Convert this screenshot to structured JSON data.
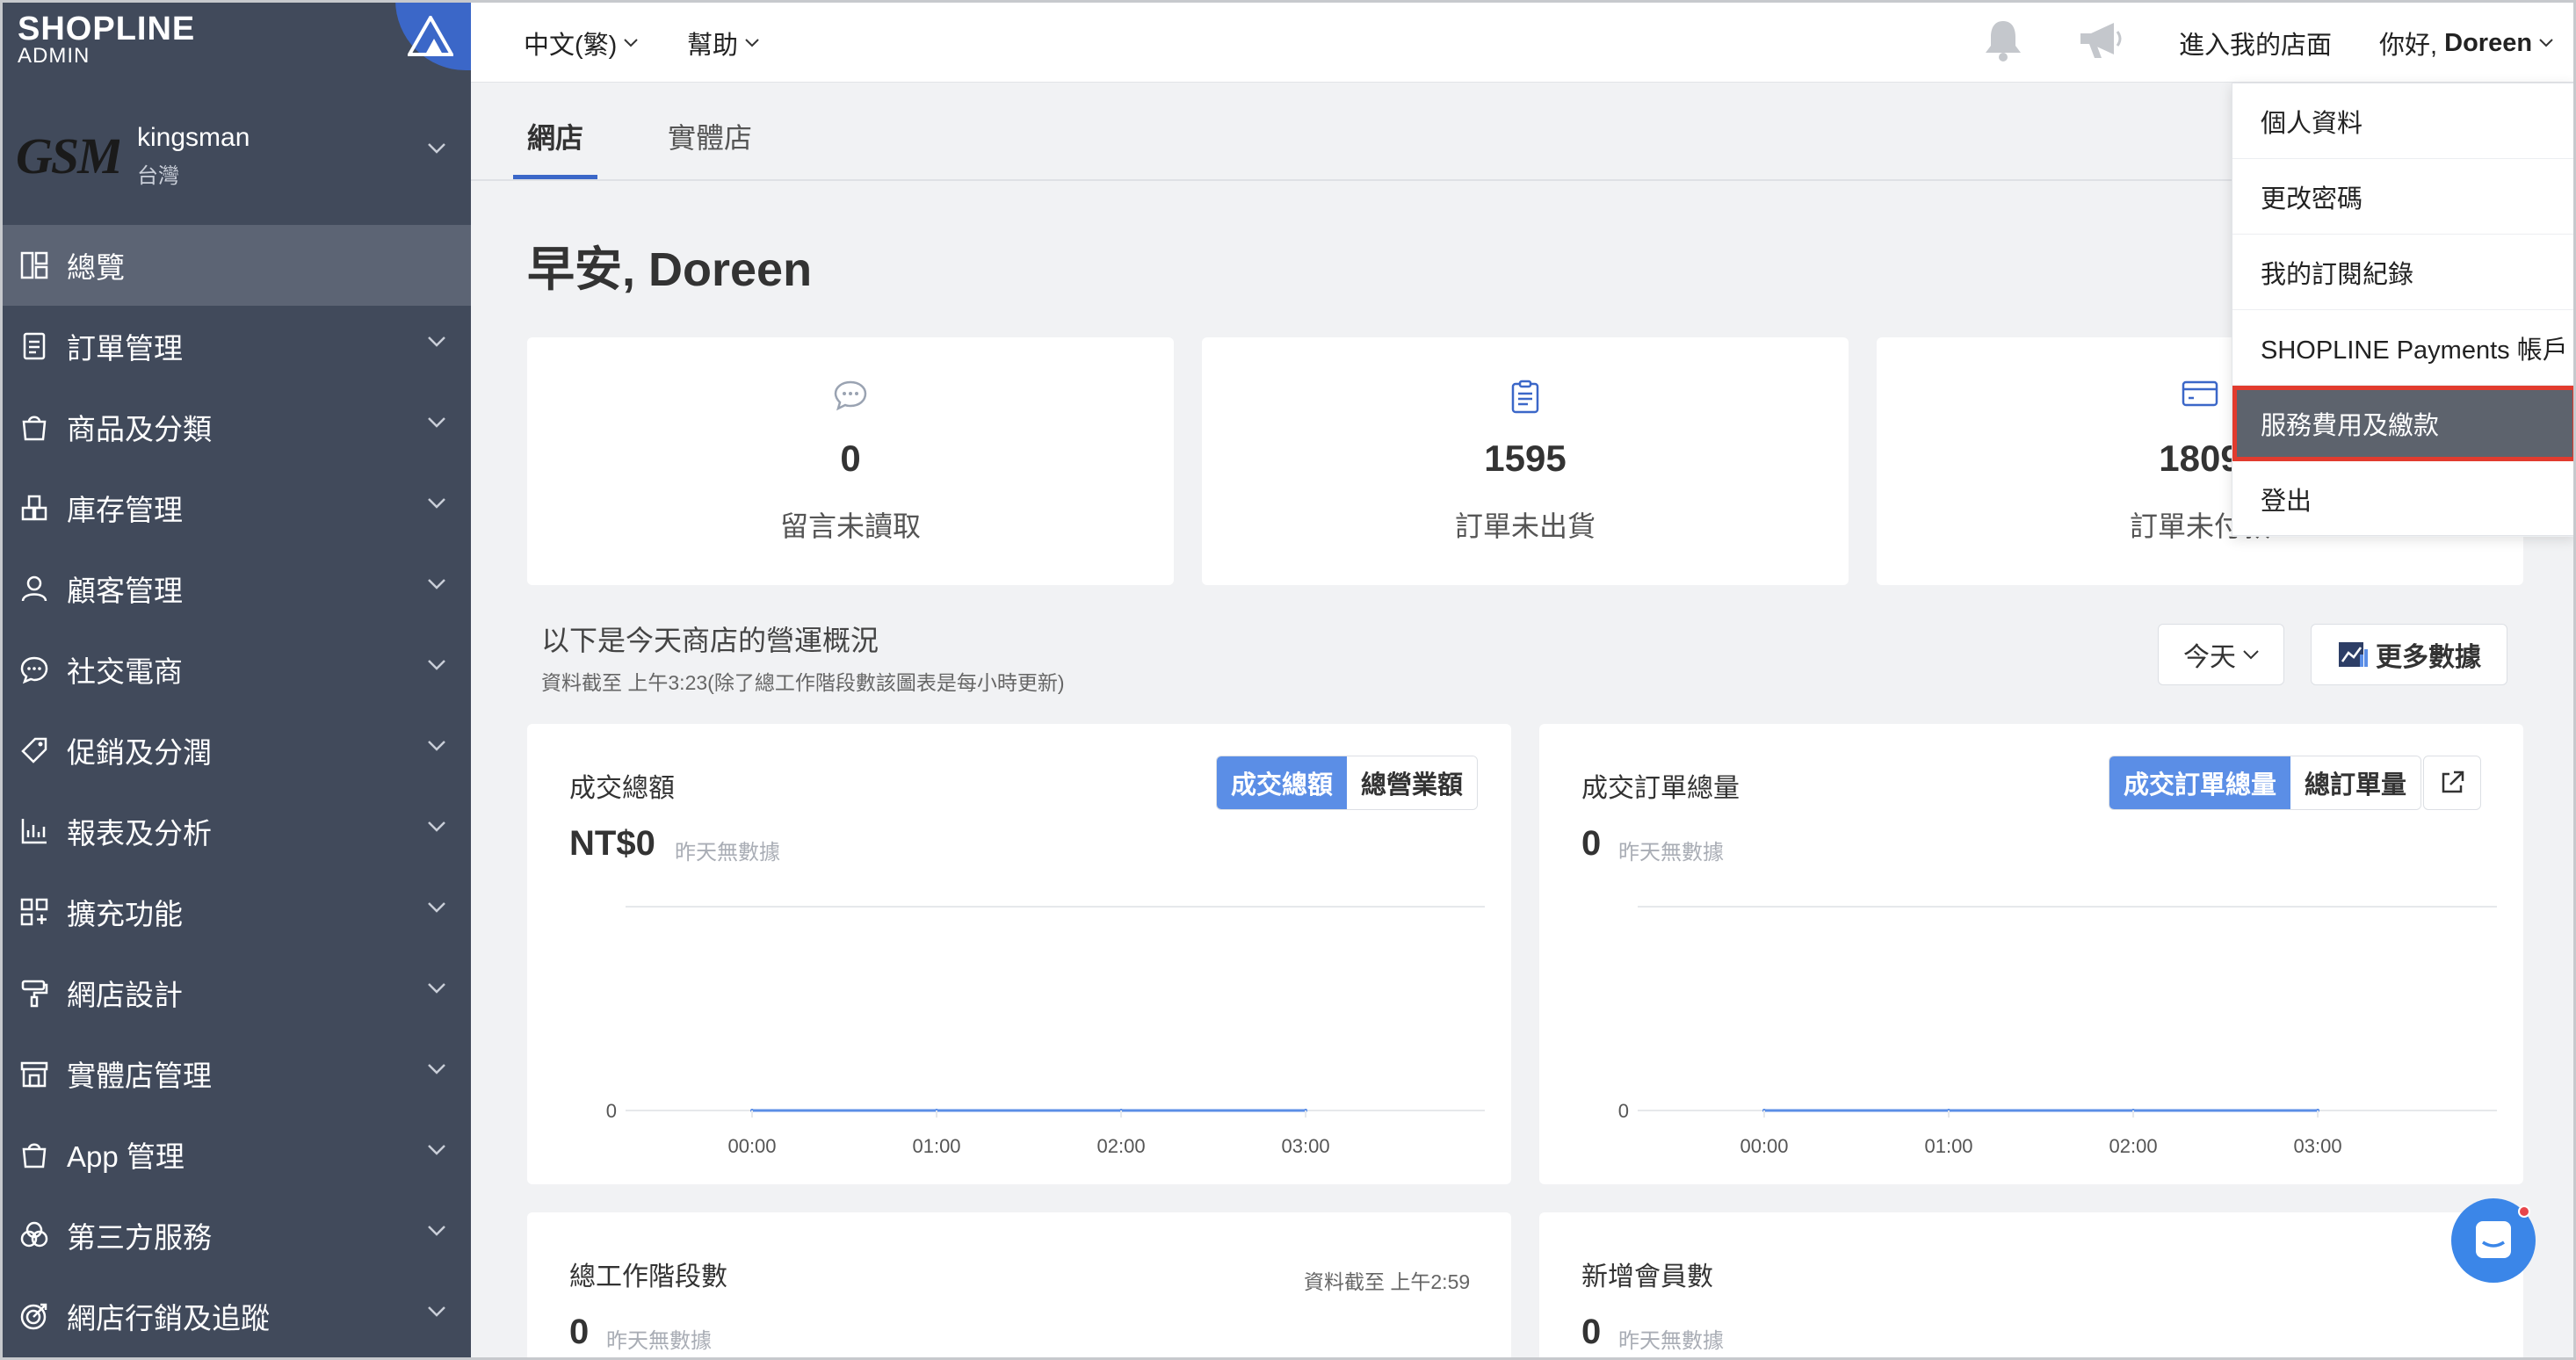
{
  "brand": {
    "name": "SHOPLINE",
    "sub": "ADMIN"
  },
  "shop": {
    "logo_text": "GSM",
    "name": "kingsman",
    "region": "台灣"
  },
  "sidebar": {
    "items": [
      {
        "label": "總覽",
        "icon": "dashboard-icon",
        "active": true
      },
      {
        "label": "訂單管理",
        "icon": "order-icon"
      },
      {
        "label": "商品及分類",
        "icon": "bag-icon"
      },
      {
        "label": "庫存管理",
        "icon": "inventory-icon"
      },
      {
        "label": "顧客管理",
        "icon": "user-icon"
      },
      {
        "label": "社交電商",
        "icon": "chat-bubble-icon"
      },
      {
        "label": "促銷及分潤",
        "icon": "tag-icon"
      },
      {
        "label": "報表及分析",
        "icon": "report-icon"
      },
      {
        "label": "擴充功能",
        "icon": "apps-icon"
      },
      {
        "label": "網店設計",
        "icon": "paint-roller-icon"
      },
      {
        "label": "實體店管理",
        "icon": "store-icon"
      },
      {
        "label": "App 管理",
        "icon": "app-bag-icon"
      },
      {
        "label": "第三方服務",
        "icon": "third-party-icon"
      },
      {
        "label": "網店行銷及追蹤",
        "icon": "target-icon"
      }
    ]
  },
  "topbar": {
    "language": "中文(繁)",
    "help": "幫助",
    "visit_store": "進入我的店面",
    "greeting_prefix": "你好,",
    "user": "Doreen"
  },
  "tabs": [
    {
      "label": "網店",
      "active": true
    },
    {
      "label": "實體店"
    }
  ],
  "greeting": "早安, Doreen",
  "stats": [
    {
      "value": "0",
      "label": "留言未讀取",
      "icon": "message-icon"
    },
    {
      "value": "1595",
      "label": "訂單未出貨",
      "icon": "clipboard-icon"
    },
    {
      "value": "1809",
      "label": "訂單未付款",
      "icon": "credit-card-icon"
    }
  ],
  "overview": {
    "title": "以下是今天商店的營運概況",
    "note_prefix": "資料截至",
    "note_time": "上午3:23",
    "note_suffix": "(除了總工作階段數該圖表是每小時更新)",
    "period": "今天",
    "more_data": "更多數據"
  },
  "cards": {
    "sales": {
      "title": "成交總額",
      "seg_on": "成交總額",
      "seg_off": "總營業額",
      "value": "NT$0",
      "sub": "昨天無數據"
    },
    "orders": {
      "title": "成交訂單總量",
      "seg_on": "成交訂單總量",
      "seg_off": "總訂單量",
      "value": "0",
      "sub": "昨天無數據"
    },
    "sessions": {
      "title": "總工作階段數",
      "note": "資料截至 上午2:59",
      "value": "0",
      "sub": "昨天無數據"
    },
    "members": {
      "title": "新增會員數",
      "value": "0",
      "sub": "昨天無數據"
    }
  },
  "chart_data": [
    {
      "type": "line",
      "title": "成交總額",
      "x": [
        "00:00",
        "01:00",
        "02:00",
        "03:00"
      ],
      "series": [
        {
          "values": [
            0,
            0,
            0,
            0
          ]
        }
      ],
      "yticks": [
        "0"
      ],
      "color": "#5b8ee6"
    },
    {
      "type": "line",
      "title": "成交訂單總量",
      "x": [
        "00:00",
        "01:00",
        "02:00",
        "03:00"
      ],
      "series": [
        {
          "values": [
            0,
            0,
            0,
            0
          ]
        }
      ],
      "yticks": [
        "0"
      ],
      "color": "#5b8ee6"
    }
  ],
  "menu": {
    "items": [
      {
        "label": "個人資料"
      },
      {
        "label": "更改密碼"
      },
      {
        "label": "我的訂閱紀錄"
      },
      {
        "label": "SHOPLINE Payments 帳戶"
      },
      {
        "label": "服務費用及繳款",
        "highlighted": true
      },
      {
        "label": "登出"
      }
    ]
  },
  "colors": {
    "sidebar": "#414a5b",
    "accent": "#5b8ee6",
    "highlight_border": "#e23b2e"
  }
}
